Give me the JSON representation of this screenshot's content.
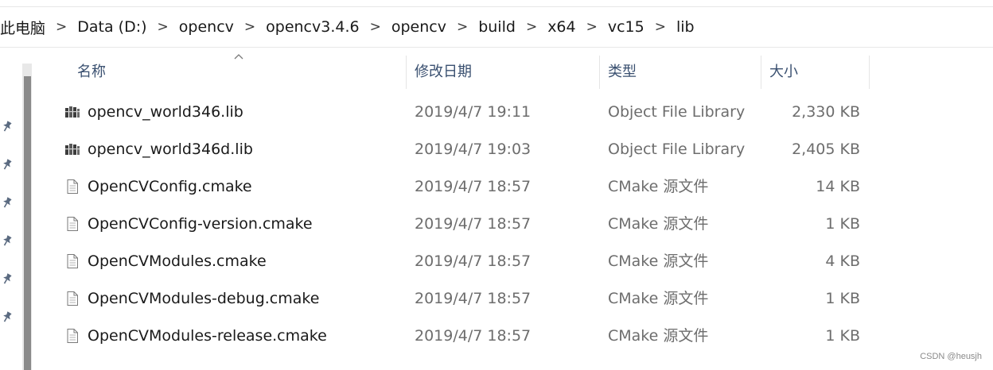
{
  "breadcrumb": [
    "此电脑",
    "Data (D:)",
    "opencv",
    "opencv3.4.6",
    "opencv",
    "build",
    "x64",
    "vc15",
    "lib"
  ],
  "breadcrumb_separator": ">",
  "columns": {
    "name": "名称",
    "date": "修改日期",
    "type": "类型",
    "size": "大小"
  },
  "sort": {
    "column": "name",
    "direction": "ascending"
  },
  "files": [
    {
      "name": "opencv_world346.lib",
      "date": "2019/4/7 19:11",
      "type": "Object File Library",
      "size": "2,330 KB",
      "icon": "library-file-icon"
    },
    {
      "name": "opencv_world346d.lib",
      "date": "2019/4/7 19:03",
      "type": "Object File Library",
      "size": "2,405 KB",
      "icon": "library-file-icon"
    },
    {
      "name": "OpenCVConfig.cmake",
      "date": "2019/4/7 18:57",
      "type": "CMake 源文件",
      "size": "14 KB",
      "icon": "document-file-icon"
    },
    {
      "name": "OpenCVConfig-version.cmake",
      "date": "2019/4/7 18:57",
      "type": "CMake 源文件",
      "size": "1 KB",
      "icon": "document-file-icon"
    },
    {
      "name": "OpenCVModules.cmake",
      "date": "2019/4/7 18:57",
      "type": "CMake 源文件",
      "size": "4 KB",
      "icon": "document-file-icon"
    },
    {
      "name": "OpenCVModules-debug.cmake",
      "date": "2019/4/7 18:57",
      "type": "CMake 源文件",
      "size": "1 KB",
      "icon": "document-file-icon"
    },
    {
      "name": "OpenCVModules-release.cmake",
      "date": "2019/4/7 18:57",
      "type": "CMake 源文件",
      "size": "1 KB",
      "icon": "document-file-icon"
    }
  ],
  "quick_access_pins": 6,
  "watermark": "CSDN @heusjh"
}
